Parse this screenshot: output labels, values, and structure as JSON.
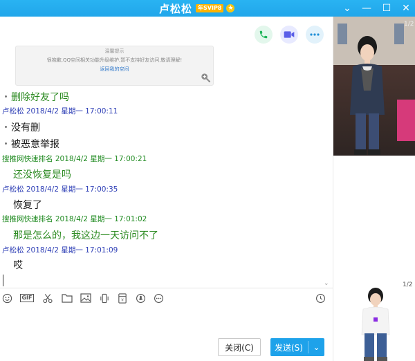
{
  "window": {
    "title": "卢松松",
    "vip_badge": "年SVIP8",
    "vip_star": "★",
    "controls": {
      "dropdown": "⌄",
      "minimize": "—",
      "maximize": "☐",
      "close": "✕"
    }
  },
  "notice": {
    "title": "温馨提示",
    "body": "很抱歉,QQ空间相关功能升级维护,暂不支持好友访问,敬请理解!",
    "link": "返回我的空间"
  },
  "messages": [
    {
      "kind": "text",
      "style": "green",
      "dot": true,
      "text": "删除好友了吗"
    },
    {
      "kind": "header",
      "style": "me",
      "text": "卢松松 2018/4/2 星期一 17:00:11"
    },
    {
      "kind": "text",
      "style": "black",
      "dot": true,
      "text": "没有删"
    },
    {
      "kind": "text",
      "style": "black",
      "dot": true,
      "text": "被恶意举报"
    },
    {
      "kind": "header",
      "style": "other",
      "text": "搜推网快速排名 2018/4/2 星期一 17:00:21"
    },
    {
      "kind": "text",
      "style": "green",
      "dot": false,
      "text": "还没恢复是吗"
    },
    {
      "kind": "header",
      "style": "me",
      "text": "卢松松 2018/4/2 星期一 17:00:35"
    },
    {
      "kind": "text",
      "style": "black",
      "dot": false,
      "text": "恢复了"
    },
    {
      "kind": "header",
      "style": "other",
      "text": "搜推网快速排名 2018/4/2 星期一 17:01:02"
    },
    {
      "kind": "text",
      "style": "green",
      "dot": false,
      "text": "那是怎么的，我这边一天访问不了"
    },
    {
      "kind": "header",
      "style": "me",
      "text": "卢松松 2018/4/2 星期一 17:01:09"
    },
    {
      "kind": "text",
      "style": "black",
      "dot": false,
      "text": "哎"
    }
  ],
  "toolbar": {
    "gif_label": "GIF"
  },
  "buttons": {
    "close": "关闭(C)",
    "send": "发送(S)",
    "send_arrow": "⌄"
  },
  "show_panel": {
    "top_page": "1/2",
    "bottom_page": "1/2"
  },
  "colors": {
    "titlebar": "#21a6ea",
    "send": "#1ea2ea",
    "green_text": "#2b8a20",
    "me_header": "#2c3db5"
  }
}
